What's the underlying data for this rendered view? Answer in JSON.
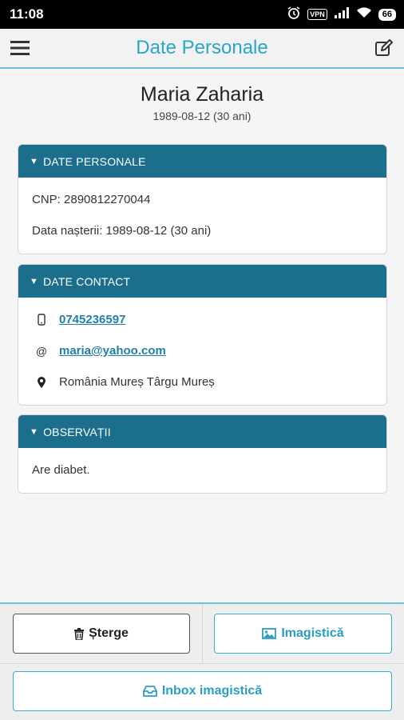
{
  "status_bar": {
    "time": "11:08",
    "vpn": "VPN",
    "battery": "66"
  },
  "app_bar": {
    "title": "Date Personale"
  },
  "profile": {
    "name": "Maria Zaharia",
    "dob_line": "1989-08-12 (30 ani)"
  },
  "personal_card": {
    "header": "DATE PERSONALE",
    "cnp": "CNP: 2890812270044",
    "birth": "Data nașterii: 1989-08-12 (30 ani)"
  },
  "contact_card": {
    "header": "DATE CONTACT",
    "phone": "0745236597",
    "email": "maria@yahoo.com",
    "address": "România Mureș Târgu Mureș"
  },
  "notes_card": {
    "header": "OBSERVAȚII",
    "text": "Are diabet."
  },
  "actions": {
    "delete_label": "Șterge",
    "imaging_label": "Imagistică",
    "inbox_label": "Inbox imagistică"
  },
  "colors": {
    "accent": "#2aa6c8",
    "card_header": "#1c6f8c",
    "link": "#1f7fa8"
  }
}
